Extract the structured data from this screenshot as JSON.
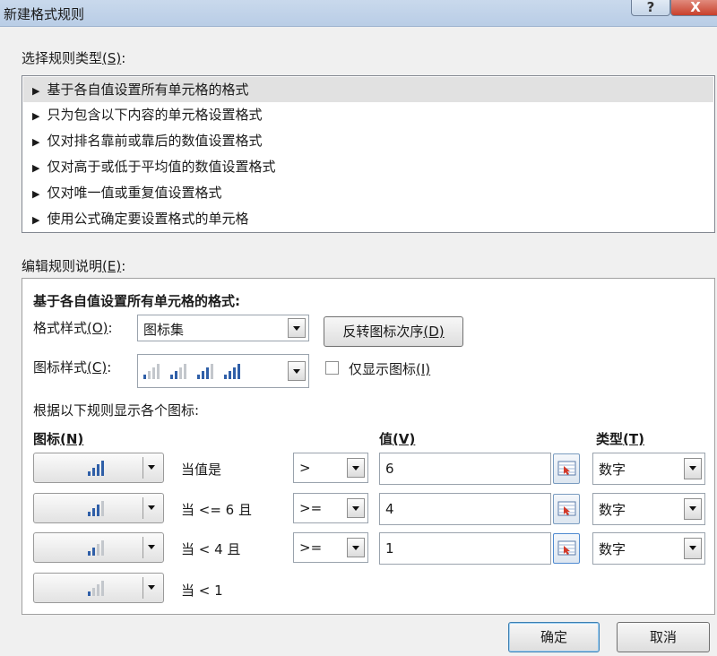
{
  "window": {
    "title": "新建格式规则",
    "help_glyph": "?",
    "close_glyph": "X"
  },
  "rule_type": {
    "label_text": "选择规则类型",
    "label_accel": "(S)",
    "label_suffix": ":",
    "items": [
      {
        "label": "基于各自值设置所有单元格的格式",
        "selected": true
      },
      {
        "label": "只为包含以下内容的单元格设置格式",
        "selected": false
      },
      {
        "label": "仅对排名靠前或靠后的数值设置格式",
        "selected": false
      },
      {
        "label": "仅对高于或低于平均值的数值设置格式",
        "selected": false
      },
      {
        "label": "仅对唯一值或重复值设置格式",
        "selected": false
      },
      {
        "label": "使用公式确定要设置格式的单元格",
        "selected": false
      }
    ]
  },
  "edit": {
    "label_text": "编辑规则说明",
    "label_accel": "(E)",
    "label_suffix": ":",
    "heading": "基于各自值设置所有单元格的格式:",
    "format_style_text": "格式样式",
    "format_style_accel": "(O)",
    "format_style_suffix": ":",
    "format_style_value": "图标集",
    "reverse_text": "反转图标次序",
    "reverse_accel": "(D)",
    "icon_style_text": "图标样式",
    "icon_style_accel": "(C)",
    "icon_style_suffix": ":",
    "show_icon_only_text": "仅显示图标",
    "show_icon_only_accel": "(I)",
    "show_icon_only_checked": false,
    "rule_intro": "根据以下规则显示各个图标:",
    "col_icon_text": "图标",
    "col_icon_accel": "(N)",
    "col_value_text": "值",
    "col_value_accel": "(V)",
    "col_type_text": "类型",
    "col_type_accel": "(T)",
    "rows": [
      {
        "bars": 4,
        "condition": "当值是",
        "operator": ">",
        "value": "6",
        "type": "数字"
      },
      {
        "bars": 3,
        "condition": "当 <= 6 且",
        "operator": ">=",
        "value": "4",
        "type": "数字"
      },
      {
        "bars": 2,
        "condition": "当 < 4 且",
        "operator": ">=",
        "value": "1",
        "type": "数字"
      },
      {
        "bars": 1,
        "condition": "当 < 1",
        "operator": null,
        "value": null,
        "type": null
      }
    ]
  },
  "buttons": {
    "ok": "确定",
    "cancel": "取消"
  },
  "colors": {
    "bar_active": "#2f5fa8",
    "bar_inactive": "#c3c7cc",
    "list_selected": "#e1e1e1"
  }
}
